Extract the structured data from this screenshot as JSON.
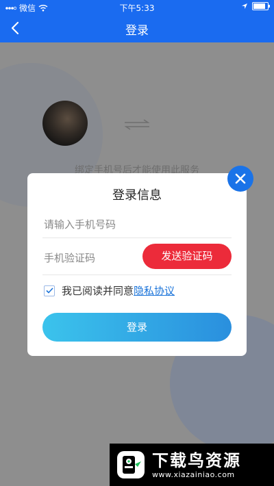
{
  "status_bar": {
    "carrier": "微信",
    "time": "下午5:33",
    "battery_level": 0.85,
    "icons": [
      "signal-icon",
      "wifi-icon",
      "location-icon",
      "battery-icon"
    ]
  },
  "nav": {
    "title": "登录",
    "back_icon": "chevron-left-icon"
  },
  "background": {
    "bind_text": "绑定手机号后才能使用此服务",
    "swap_icon": "swap-arrows-icon"
  },
  "dialog": {
    "title": "登录信息",
    "phone_placeholder": "请输入手机号码",
    "code_placeholder": "手机验证码",
    "send_code_label": "发送验证码",
    "agree_text": "我已阅读并同意",
    "privacy_link": "隐私协议",
    "agree_checked": true,
    "login_label": "登录",
    "close_icon": "close-icon"
  },
  "colors": {
    "brand_blue": "#1a6bf0",
    "send_red": "#ec2b3a",
    "login_gradient_start": "#3bc3ec",
    "login_gradient_end": "#2a8fde",
    "link_blue": "#1a73d9"
  },
  "watermark": {
    "title": "下载鸟资源",
    "url": "www.xiazainiao.com"
  }
}
